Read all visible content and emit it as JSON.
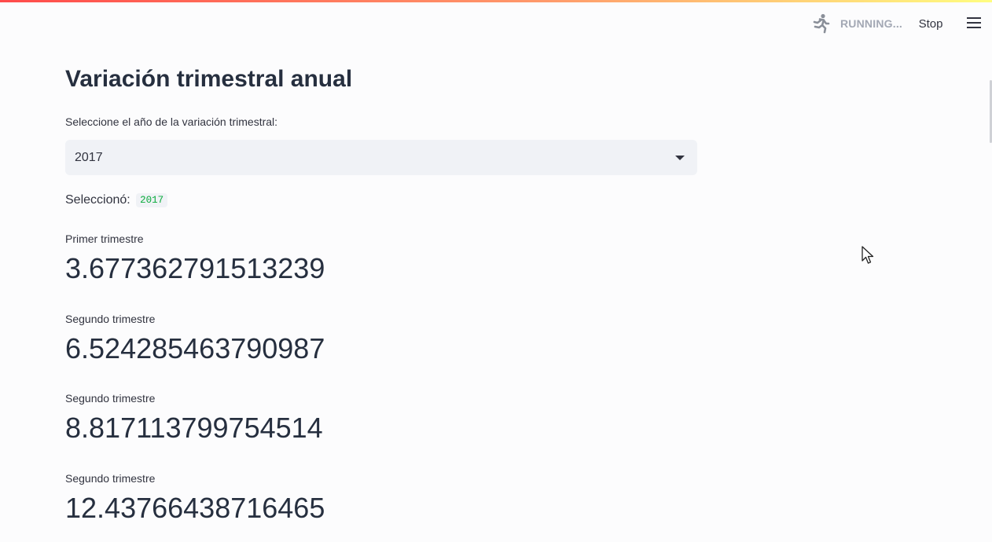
{
  "header": {
    "status_text": "RUNNING...",
    "status_icon": "running-man-icon",
    "stop_label": "Stop",
    "menu_icon": "hamburger-menu-icon"
  },
  "main": {
    "title": "Variación trimestral anual",
    "select": {
      "label": "Seleccione el año de la variación trimestral:",
      "value": "2017"
    },
    "selected_text": "Seleccionó:",
    "selected_code": "2017",
    "metrics": [
      {
        "label": "Primer trimestre",
        "value": "3.677362791513239"
      },
      {
        "label": "Segundo trimestre",
        "value": "6.524285463790987"
      },
      {
        "label": "Segundo trimestre",
        "value": "8.817113799754514"
      },
      {
        "label": "Segundo trimestre",
        "value": "12.43766438716465"
      }
    ]
  },
  "colors": {
    "accent_red": "#ff4b4b",
    "code_green": "#09ab3b",
    "text_dark": "#262f3f",
    "select_bg": "#f0f2f6"
  }
}
